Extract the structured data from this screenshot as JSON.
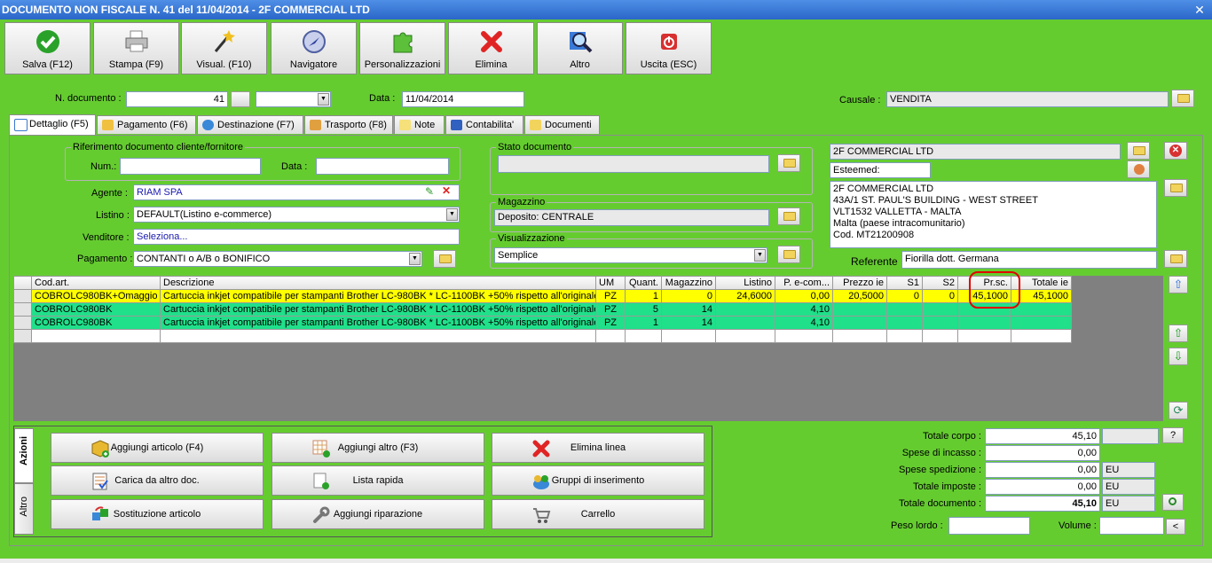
{
  "window": {
    "title": "DOCUMENTO NON FISCALE N. 41 del 11/04/2014 - 2F COMMERCIAL LTD",
    "close_glyph": "✕"
  },
  "toolbar": [
    {
      "label": "Salva (F12)",
      "icon": "check-icon"
    },
    {
      "label": "Stampa (F9)",
      "icon": "printer-icon"
    },
    {
      "label": "Visual. (F10)",
      "icon": "magic-wand-icon"
    },
    {
      "label": "Navigatore",
      "icon": "compass-icon"
    },
    {
      "label": "Personalizzazioni",
      "icon": "puzzle-icon"
    },
    {
      "label": "Elimina",
      "icon": "delete-x-icon"
    },
    {
      "label": "Altro",
      "icon": "magnifier-icon"
    },
    {
      "label": "Uscita (ESC)",
      "icon": "power-icon"
    }
  ],
  "header": {
    "ndoc_label": "N. documento :",
    "ndoc_value": "41",
    "data_label": "Data :",
    "data_value": "11/04/2014",
    "causale_label": "Causale :",
    "causale_value": "VENDITA"
  },
  "tabs": [
    "Dettaglio (F5)",
    "Pagamento (F6)",
    "Destinazione (F7)",
    "Trasporto (F8)",
    "Note",
    "Contabilita'",
    "Documenti"
  ],
  "rif": {
    "title": "Riferimento documento cliente/fornitore",
    "num_label": "Num.:",
    "data_label": "Data :"
  },
  "agente": {
    "label": "Agente :",
    "value": "RIAM SPA"
  },
  "listino": {
    "label": "Listino :",
    "value": "DEFAULT(Listino e-commerce)"
  },
  "venditore": {
    "label": "Venditore :",
    "value": "Seleziona..."
  },
  "pagamento": {
    "label": "Pagamento :",
    "value": "CONTANTI o A/B o BONIFICO"
  },
  "stato": {
    "title": "Stato documento",
    "value": ""
  },
  "magazzino": {
    "title": "Magazzino",
    "value": "Deposito: CENTRALE"
  },
  "visualizzazione": {
    "title": "Visualizzazione",
    "value": "Semplice"
  },
  "cliente": {
    "name": "2F COMMERCIAL LTD",
    "esteemed": "Esteemed:",
    "address": [
      "2F COMMERCIAL LTD",
      "43A/1 ST. PAUL'S BUILDING - WEST STREET",
      "VLT1532 VALLETTA - MALTA",
      "Malta (paese intracomunitario)",
      "Cod.  MT21200908"
    ],
    "referente_label": "Referente",
    "referente_value": "Fiorilla dott. Germana"
  },
  "grid": {
    "columns": [
      "Cod.art.",
      "Descrizione",
      "UM",
      "Quant.",
      "Magazzino",
      "Listino",
      "P. e-com...",
      "Prezzo ie",
      "S1",
      "S2",
      "Pr.sc.",
      "Totale ie"
    ],
    "rows": [
      {
        "style": "yellow",
        "cells": [
          "COBROLC980BK+Omaggio",
          "Cartuccia inkjet compatibile per stampanti Brother LC-980BK * LC-1100BK +50% rispetto all'originale",
          "PZ",
          "1",
          "0",
          "24,6000",
          "0,00",
          "20,5000",
          "0",
          "0",
          "45,1000",
          "45,1000"
        ]
      },
      {
        "style": "green",
        "cells": [
          "COBROLC980BK",
          "Cartuccia inkjet compatibile per stampanti Brother LC-980BK * LC-1100BK +50% rispetto all'originale",
          "PZ",
          "5",
          "14",
          "",
          "4,10",
          "",
          "",
          "",
          "",
          ""
        ]
      },
      {
        "style": "green",
        "cells": [
          "COBROLC980BK",
          "Cartuccia inkjet compatibile per stampanti Brother LC-980BK * LC-1100BK +50% rispetto all'originale",
          "PZ",
          "1",
          "14",
          "",
          "4,10",
          "",
          "",
          "",
          "",
          ""
        ]
      },
      {
        "style": "white",
        "cells": [
          "",
          "",
          "",
          "",
          "",
          "",
          "",
          "",
          "",
          "",
          "",
          ""
        ]
      }
    ]
  },
  "actions": {
    "tab_azioni": "Azioni",
    "tab_altro": "Altro",
    "buttons": [
      {
        "label": "Aggiungi articolo (F4)",
        "icon": "add-box-icon"
      },
      {
        "label": "Aggiungi altro (F3)",
        "icon": "add-grid-icon"
      },
      {
        "label": "Elimina linea",
        "icon": "delete-x-icon"
      },
      {
        "label": "Carica da altro doc.",
        "icon": "load-doc-icon"
      },
      {
        "label": "Lista rapida",
        "icon": "quick-list-icon"
      },
      {
        "label": "Gruppi di inserimento",
        "icon": "group-icon"
      },
      {
        "label": "Sostituzione articolo",
        "icon": "replace-icon"
      },
      {
        "label": "Aggiungi riparazione",
        "icon": "wrench-icon"
      },
      {
        "label": "Carrello",
        "icon": "cart-icon"
      }
    ]
  },
  "totals": {
    "totale_corpo": {
      "label": "Totale corpo :",
      "value": "45,10",
      "btn": "?"
    },
    "spese_incasso": {
      "label": "Spese di incasso :",
      "value": "0,00"
    },
    "spese_spedizione": {
      "label": "Spese spedizione :",
      "value": "0,00",
      "unit": "EU"
    },
    "totale_imposte": {
      "label": "Totale imposte :",
      "value": "0,00",
      "unit": "EU"
    },
    "totale_documento": {
      "label": "Totale documento :",
      "value": "45,10",
      "unit": "EU"
    },
    "peso_label": "Peso lordo :",
    "volume_label": "Volume :",
    "volume_btn": "<"
  },
  "colors": {
    "background": "#65cc30",
    "titlebar": "#2a66c8",
    "row_yellow": "#ffff00",
    "row_green": "#20e08a",
    "highlight": "#e00000"
  }
}
